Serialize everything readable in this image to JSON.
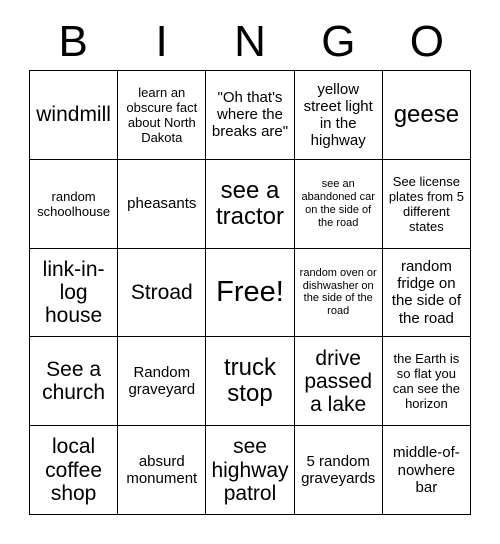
{
  "card": {
    "header_letters": [
      "B",
      "I",
      "N",
      "G",
      "O"
    ],
    "free_space_index": 12,
    "colors": {
      "border": "#000000",
      "text": "#000000",
      "background": "#ffffff"
    },
    "cells": [
      {
        "text": "windmill",
        "size": "xl"
      },
      {
        "text": "learn an obscure fact about North Dakota",
        "size": "sm"
      },
      {
        "text": "\"Oh that's where the breaks are\"",
        "size": "md"
      },
      {
        "text": "yellow street light in the highway",
        "size": "md"
      },
      {
        "text": "geese",
        "size": "xxl"
      },
      {
        "text": "random schoolhouse",
        "size": "sm"
      },
      {
        "text": "pheasants",
        "size": "md"
      },
      {
        "text": "see a tractor",
        "size": "xxl"
      },
      {
        "text": "see an abandoned car on the side of the road",
        "size": "xs"
      },
      {
        "text": "See license plates from 5 different states",
        "size": "sm"
      },
      {
        "text": "link-in-log house",
        "size": "xl"
      },
      {
        "text": "Stroad",
        "size": "xl"
      },
      {
        "text": "Free!",
        "size": "free"
      },
      {
        "text": "random oven or dishwasher on the side of the road",
        "size": "xs"
      },
      {
        "text": "random fridge on the side of the road",
        "size": "md"
      },
      {
        "text": "See a church",
        "size": "xl"
      },
      {
        "text": "Random graveyard",
        "size": "md"
      },
      {
        "text": "truck stop",
        "size": "xxl"
      },
      {
        "text": "drive passed a lake",
        "size": "xl"
      },
      {
        "text": "the Earth is so flat you can see the horizon",
        "size": "sm"
      },
      {
        "text": "local coffee shop",
        "size": "xl"
      },
      {
        "text": "absurd monument",
        "size": "md"
      },
      {
        "text": "see highway patrol",
        "size": "xl"
      },
      {
        "text": "5 random graveyards",
        "size": "md"
      },
      {
        "text": "middle-of-nowhere bar",
        "size": "md"
      }
    ]
  }
}
